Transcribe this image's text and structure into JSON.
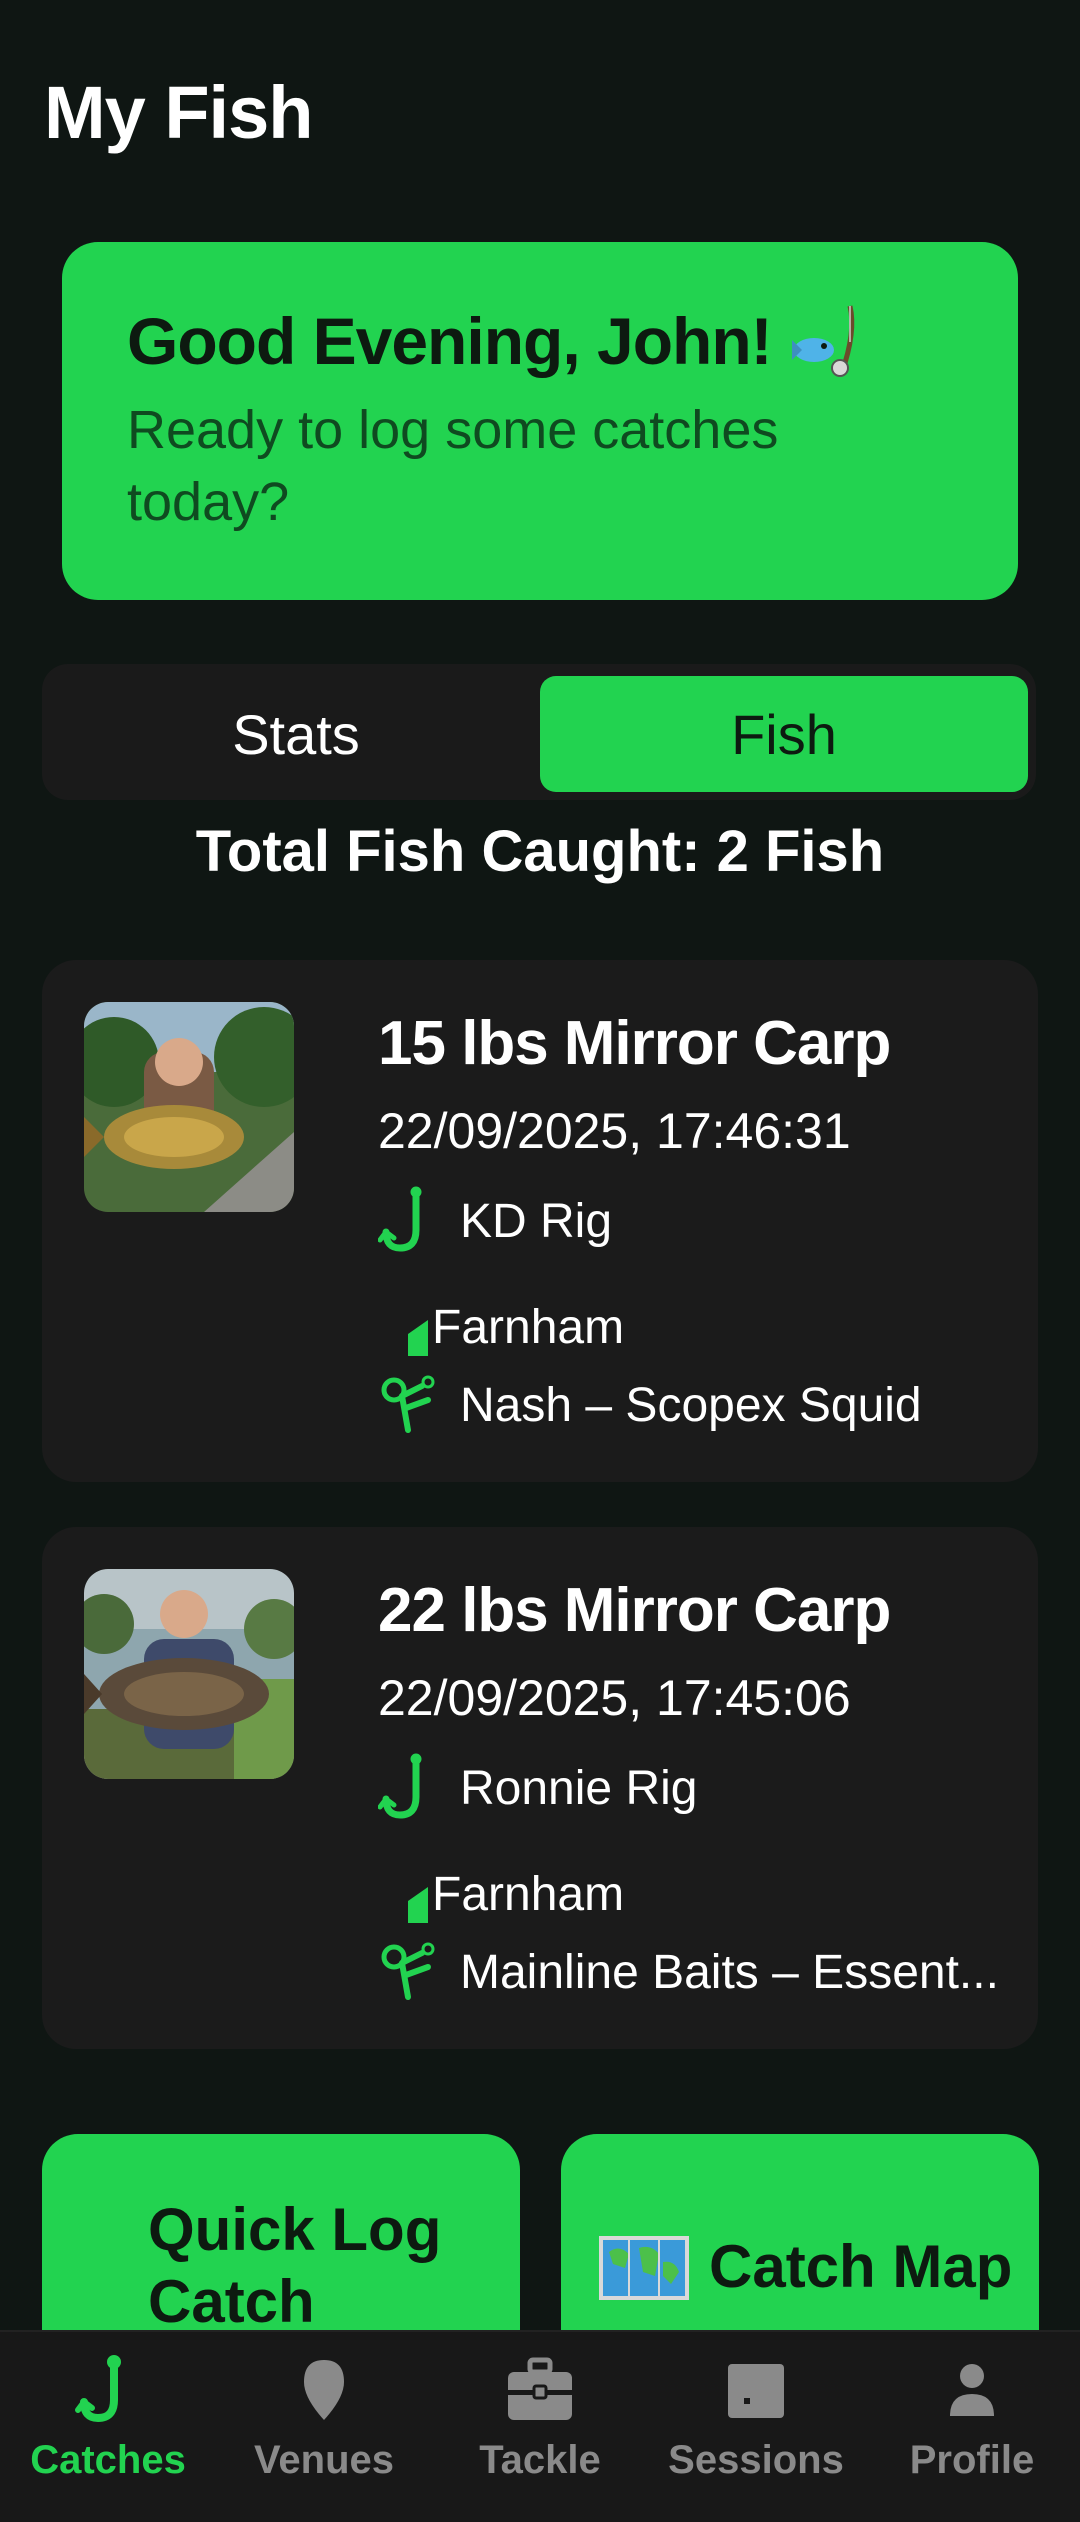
{
  "page": {
    "title": "My Fish"
  },
  "greeting": {
    "title": "Good Evening, John!",
    "emoji_icon": "fishing-pole-emoji",
    "subtitle": "Ready to log some catches today?"
  },
  "tabs": {
    "items": [
      {
        "label": "Stats",
        "selected": false
      },
      {
        "label": "Fish",
        "selected": true
      }
    ]
  },
  "summary": {
    "total_text": "Total Fish Caught: 2 Fish"
  },
  "catches": [
    {
      "weight": "15 lbs",
      "species": "Mirror Carp",
      "datetime": "22/09/2025, 17:46:31",
      "rig": "KD Rig",
      "venue": "Farnham",
      "bait": "Nash – Scopex Squid"
    },
    {
      "weight": "22 lbs",
      "species": "Mirror Carp",
      "datetime": "22/09/2025, 17:45:06",
      "rig": "Ronnie Rig",
      "venue": "Farnham",
      "bait": "Mainline Baits – Essent..."
    }
  ],
  "actions": {
    "quick_log": "Quick Log Catch",
    "catch_map": "Catch Map",
    "catch_map_icon": "world-map-emoji"
  },
  "bottom_nav": {
    "items": [
      {
        "label": "Catches",
        "icon": "hook-icon",
        "active": true
      },
      {
        "label": "Venues",
        "icon": "location-pin-icon",
        "active": false
      },
      {
        "label": "Tackle",
        "icon": "tackle-box-icon",
        "active": false
      },
      {
        "label": "Sessions",
        "icon": "sessions-icon",
        "active": false
      },
      {
        "label": "Profile",
        "icon": "person-icon",
        "active": false
      }
    ]
  },
  "colors": {
    "accent": "#22d350",
    "background": "#0f1613",
    "card": "#1b1b1b",
    "inactive": "#8a8a8a"
  }
}
